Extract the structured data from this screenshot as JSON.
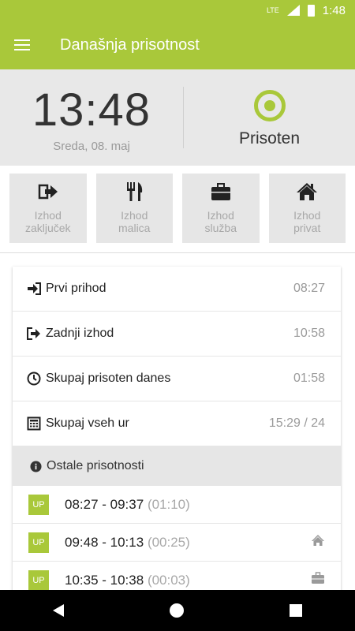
{
  "status_bar": {
    "signal": "LTE",
    "time": "1:48"
  },
  "app_bar": {
    "title": "Današnja prisotnost"
  },
  "hero": {
    "clock": "13:48",
    "date": "Sreda, 08. maj",
    "status": "Prisoten"
  },
  "actions": [
    {
      "line1": "Izhod",
      "line2": "zaključek",
      "icon": "exit-icon"
    },
    {
      "line1": "Izhod",
      "line2": "malica",
      "icon": "fork-knife-icon"
    },
    {
      "line1": "Izhod",
      "line2": "služba",
      "icon": "briefcase-icon"
    },
    {
      "line1": "Izhod",
      "line2": "privat",
      "icon": "home-icon"
    }
  ],
  "summary": [
    {
      "label": "Prvi prihod",
      "value": "08:27",
      "icon": "sign-in-icon"
    },
    {
      "label": "Zadnji izhod",
      "value": "10:58",
      "icon": "sign-out-icon"
    },
    {
      "label": "Skupaj prisoten danes",
      "value": "01:58",
      "icon": "clock-icon"
    },
    {
      "label": "Skupaj vseh ur",
      "value": "15:29 / 24",
      "icon": "calculator-icon"
    }
  ],
  "other": {
    "title": "Ostale prisotnosti",
    "entries": [
      {
        "badge": "UP",
        "range": "08:27 - 09:37",
        "duration": "(01:10)",
        "icon": ""
      },
      {
        "badge": "UP",
        "range": "09:48 - 10:13",
        "duration": "(00:25)",
        "icon": "home-icon"
      },
      {
        "badge": "UP",
        "range": "10:35 - 10:38",
        "duration": "(00:03)",
        "icon": "briefcase-icon"
      }
    ]
  },
  "colors": {
    "accent": "#a9c83a",
    "hero_bg": "#e8e8e8",
    "button_bg": "#e6e6e6"
  }
}
